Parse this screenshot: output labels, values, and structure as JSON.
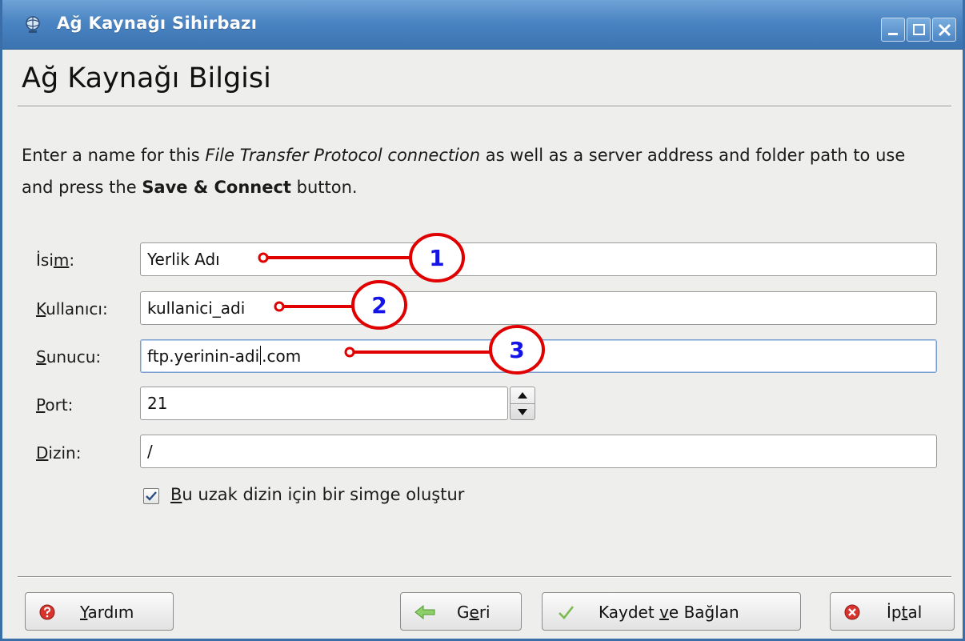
{
  "window": {
    "title": "Ağ Kaynağı Sihirbazı"
  },
  "page": {
    "title": "Ağ Kaynağı Bilgisi",
    "instructions": {
      "part1": "Enter a name for this ",
      "italic": "File Transfer Protocol connection",
      "part2": " as well as a server address and folder path to use and press the ",
      "bold": "Save & Connect",
      "part3": " button."
    }
  },
  "form": {
    "name": {
      "label_pre": "İsi",
      "label_key": "m",
      "label_post": ":",
      "value": "Yerlik Adı"
    },
    "user": {
      "label_pre": "",
      "label_key": "K",
      "label_post": "ullanıcı:",
      "value": "kullanici_adi"
    },
    "server": {
      "label_pre": "",
      "label_key": "S",
      "label_post": "unucu:",
      "value_before_caret": "ftp.yerinin-adi",
      "value_after_caret": ".com"
    },
    "port": {
      "label_pre": "",
      "label_key": "P",
      "label_post": "ort:",
      "value": "21"
    },
    "folder": {
      "label_pre": "",
      "label_key": "D",
      "label_post": "izin:",
      "value": "/"
    },
    "icon_checkbox": {
      "checked": true,
      "label_key": "B",
      "label_post": "u uzak dizin için bir simge oluştur"
    }
  },
  "annotations": [
    "1",
    "2",
    "3"
  ],
  "buttons": {
    "help": {
      "key": "Y",
      "post": "ardım"
    },
    "back": {
      "pre": "G",
      "key": "e",
      "post": "ri"
    },
    "save": {
      "pre": "Kaydet ",
      "key": "v",
      "post": "e Bağlan"
    },
    "cancel": {
      "pre": "İp",
      "key": "t",
      "post": "al"
    }
  },
  "colors": {
    "titlebar": "#4a84c2",
    "annotation": "#e00000",
    "annotation_number": "#1414e6"
  }
}
